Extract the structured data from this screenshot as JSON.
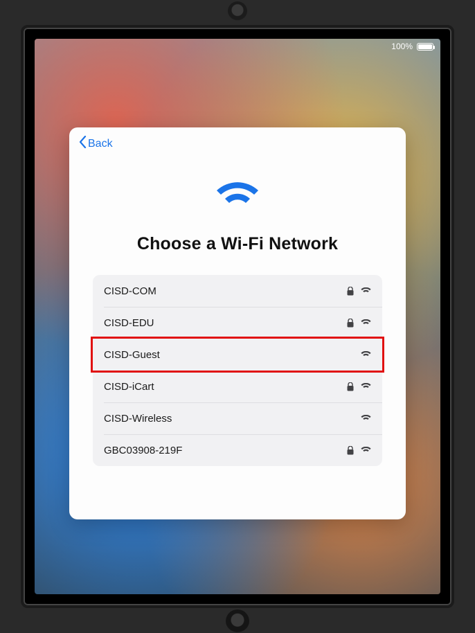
{
  "status": {
    "battery_text": "100%"
  },
  "modal": {
    "back_label": "Back",
    "title": "Choose a Wi-Fi Network"
  },
  "networks": [
    {
      "ssid": "CISD-COM",
      "secured": true,
      "highlighted": false
    },
    {
      "ssid": "CISD-EDU",
      "secured": true,
      "highlighted": false
    },
    {
      "ssid": "CISD-Guest",
      "secured": false,
      "highlighted": true
    },
    {
      "ssid": "CISD-iCart",
      "secured": true,
      "highlighted": false
    },
    {
      "ssid": "CISD-Wireless",
      "secured": false,
      "highlighted": false
    },
    {
      "ssid": "GBC03908-219F",
      "secured": true,
      "highlighted": false
    }
  ],
  "colors": {
    "accent": "#1b74e8",
    "highlight_border": "#e11010",
    "list_bg": "#f1f1f3"
  }
}
